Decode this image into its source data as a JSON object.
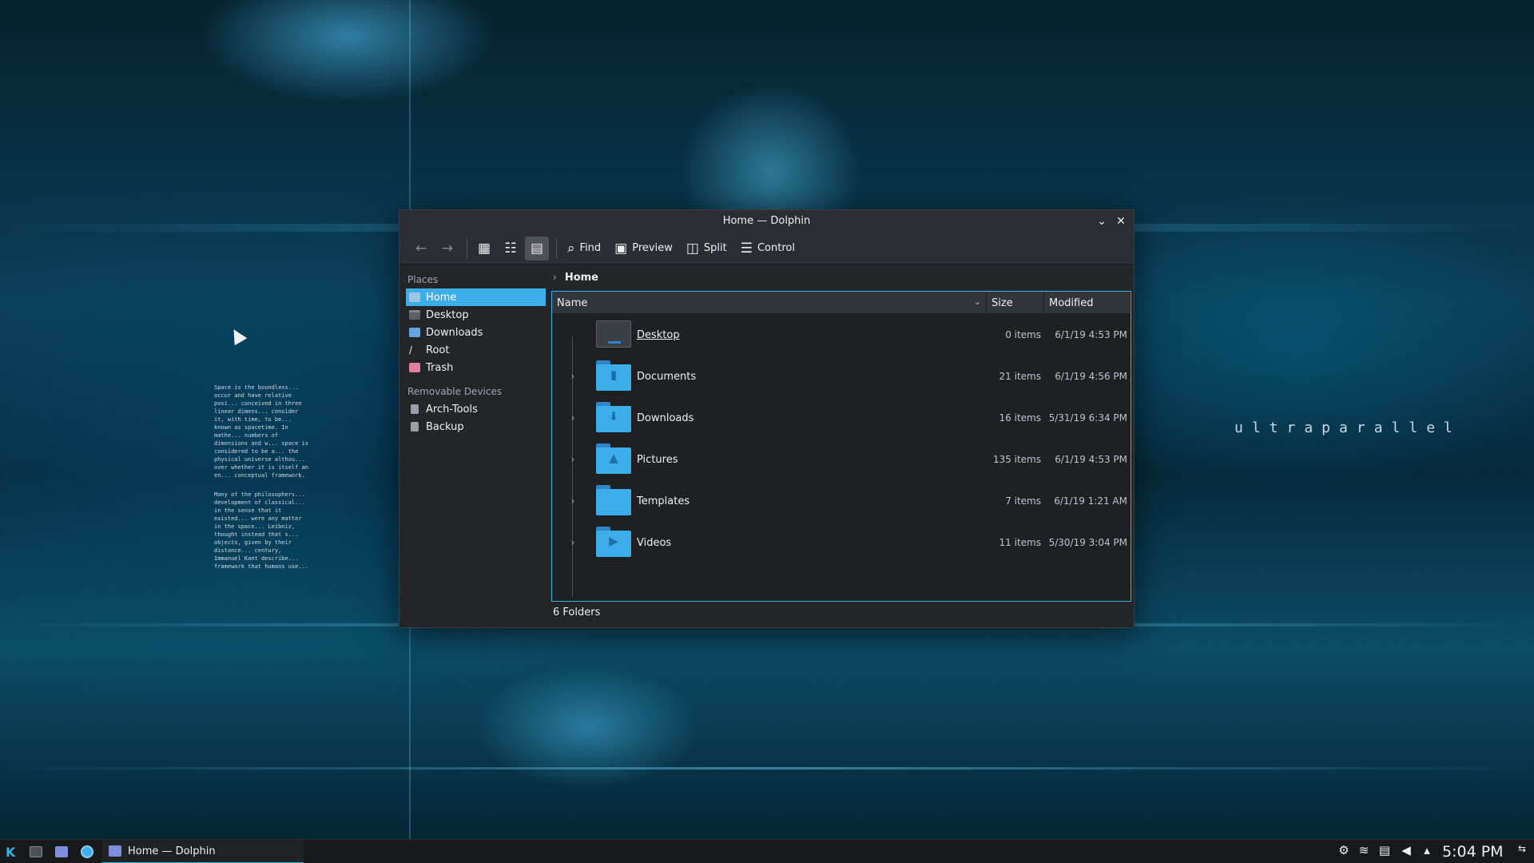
{
  "wallpaper": {
    "brand_text": "ultraparallel",
    "paragraphs": [
      "Space is the boundless... occur and have relative posi... conceived in three linear dimens... consider it, with time, to be... known as spacetime. In mathe... numbers of dimensions and w... space is considered to be a... the physical universe althou... over whether it is itself an en... conceptual framework.",
      "Many of the philosophers... development of classical... in the sense that it existed... were any matter in the space... Leibniz, thought instead that s... objects, given by their distance... century, Immanuel Kant describe... framework that humans use..."
    ]
  },
  "window": {
    "title": "Home — Dolphin",
    "minimize_icon": "chevron-down-icon",
    "close_icon": "close-icon"
  },
  "toolbar": {
    "back_icon": "arrow-left-icon",
    "forward_icon": "arrow-right-icon",
    "icons_view_icon": "grid-view-icon",
    "compact_view_icon": "compact-view-icon",
    "details_view_icon": "details-view-icon",
    "find_label": "Find",
    "preview_label": "Preview",
    "split_label": "Split",
    "control_label": "Control"
  },
  "sidebar": {
    "places_title": "Places",
    "places": [
      {
        "label": "Home",
        "icon": "home-icon",
        "selected": true
      },
      {
        "label": "Desktop",
        "icon": "desktop-icon"
      },
      {
        "label": "Downloads",
        "icon": "downloads-icon"
      },
      {
        "label": "Root",
        "icon": "root-icon"
      },
      {
        "label": "Trash",
        "icon": "trash-icon"
      }
    ],
    "removable_title": "Removable Devices",
    "devices": [
      {
        "label": "Arch-Tools",
        "icon": "drive-icon"
      },
      {
        "label": "Backup",
        "icon": "drive-icon"
      }
    ]
  },
  "breadcrumb": {
    "current": "Home"
  },
  "columns": {
    "name": "Name",
    "size": "Size",
    "modified": "Modified"
  },
  "files": [
    {
      "name": "Desktop",
      "size": "0 items",
      "modified": "6/1/19 4:53 PM",
      "icon": "desktop-folder-icon",
      "expandable": false
    },
    {
      "name": "Documents",
      "size": "21 items",
      "modified": "6/1/19 4:56 PM",
      "icon": "documents-folder-icon",
      "expandable": true
    },
    {
      "name": "Downloads",
      "size": "16 items",
      "modified": "5/31/19 6:34 PM",
      "icon": "downloads-folder-icon",
      "expandable": true
    },
    {
      "name": "Pictures",
      "size": "135 items",
      "modified": "6/1/19 4:53 PM",
      "icon": "pictures-folder-icon",
      "expandable": true
    },
    {
      "name": "Templates",
      "size": "7 items",
      "modified": "6/1/19 1:21 AM",
      "icon": "templates-folder-icon",
      "expandable": true
    },
    {
      "name": "Videos",
      "size": "11 items",
      "modified": "5/30/19 3:04 PM",
      "icon": "videos-folder-icon",
      "expandable": true
    }
  ],
  "status_text": "6 Folders",
  "taskbar": {
    "task_label": "Home — Dolphin",
    "clock": "5:04 PM"
  },
  "colors": {
    "accent": "#3daee9",
    "window_bg": "#232629",
    "panel_bg": "#17191b"
  }
}
